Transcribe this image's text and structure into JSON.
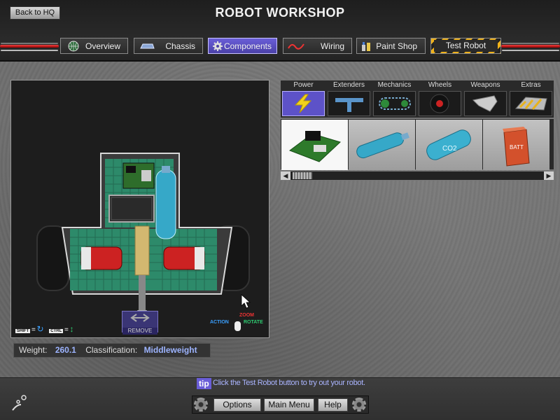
{
  "header": {
    "back_label": "Back to HQ",
    "title": "ROBOT WORKSHOP",
    "tabs": [
      {
        "label": "Overview",
        "icon": "globe-icon"
      },
      {
        "label": "Chassis",
        "icon": "chassis-icon"
      },
      {
        "label": "Components",
        "icon": "gear-icon",
        "active": true
      },
      {
        "label": "Wiring",
        "icon": "wire-icon"
      },
      {
        "label": "Paint Shop",
        "icon": "paint-icon"
      },
      {
        "label": "Test Robot",
        "icon": "hazard-stripes"
      }
    ]
  },
  "viewport": {
    "remove_label": "REMOVE",
    "key_shift": "SHIFT",
    "key_ctrl": "CTRL",
    "eq": "=",
    "zoom_label": "ZOOM",
    "action_label": "ACTION",
    "rotate_label": "ROTATE"
  },
  "info": {
    "weight_label": "Weight:",
    "weight_value": "260.1",
    "class_label": "Classification:",
    "class_value": "Middleweight"
  },
  "categories": [
    {
      "label": "Power",
      "icon": "lightning-icon",
      "active": true
    },
    {
      "label": "Extenders",
      "icon": "extender-icon"
    },
    {
      "label": "Mechanics",
      "icon": "chain-icon"
    },
    {
      "label": "Wheels",
      "icon": "wheel-icon"
    },
    {
      "label": "Weapons",
      "icon": "blade-icon"
    },
    {
      "label": "Extras",
      "icon": "plow-icon"
    }
  ],
  "parts": [
    {
      "name": "circuit-board",
      "text": ""
    },
    {
      "name": "blue-tank",
      "text": ""
    },
    {
      "name": "co2-tank",
      "text": "CO2"
    },
    {
      "name": "battery-box",
      "text": "BATT"
    }
  ],
  "footer": {
    "tip_badge": "tip",
    "tip_text": "Click the Test Robot button to try out your robot.",
    "options_label": "Options",
    "main_menu_label": "Main Menu",
    "help_label": "Help"
  },
  "colors": {
    "accent": "#5d52c8",
    "value_text": "#9db4ff",
    "board_green": "#2d8a6a"
  }
}
